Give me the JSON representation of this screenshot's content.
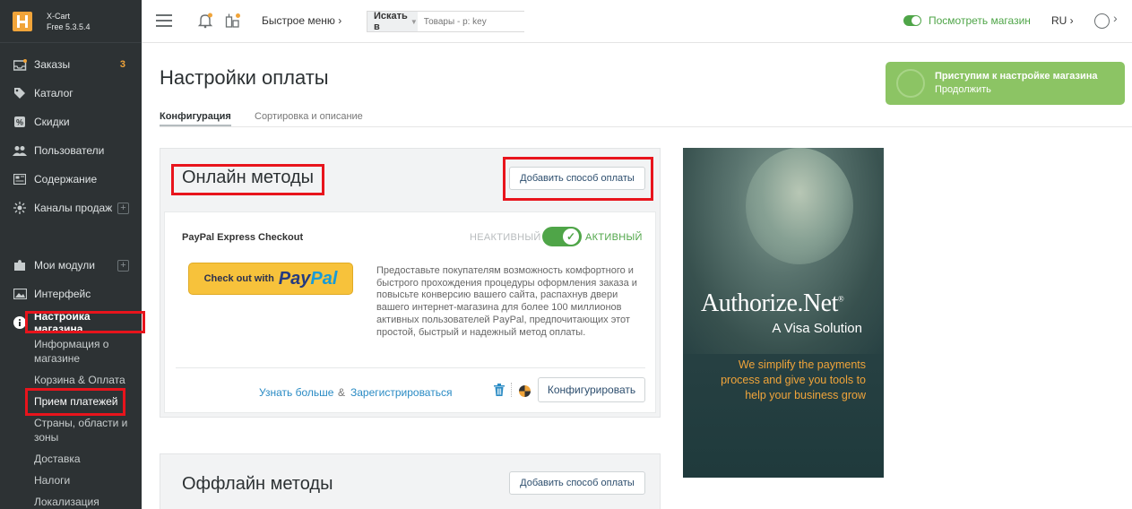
{
  "app": {
    "name": "X-Cart",
    "version": "Free 5.3.5.4"
  },
  "sidebar": {
    "items": [
      {
        "label": "Заказы",
        "badge": "3",
        "icon": "inbox-icon"
      },
      {
        "label": "Каталог",
        "icon": "tag-icon"
      },
      {
        "label": "Скидки",
        "icon": "discount-icon"
      },
      {
        "label": "Пользователи",
        "icon": "users-icon"
      },
      {
        "label": "Содержание",
        "icon": "content-icon"
      },
      {
        "label": "Каналы продаж",
        "icon": "sales-channels-icon",
        "plus": "+"
      },
      {
        "label": "Мои модули",
        "icon": "puzzle-icon",
        "plus": "+"
      },
      {
        "label": "Интерфейс",
        "icon": "image-icon"
      },
      {
        "label": "Настройка магазина",
        "icon": "info-icon"
      }
    ],
    "subitems": [
      "Информация о магазине",
      "Корзина & Оплата",
      "Прием платежей",
      "Страны, области и зоны",
      "Доставка",
      "Налоги",
      "Локализация"
    ]
  },
  "topbar": {
    "quick_menu": "Быстрое меню",
    "search_scope": "Искать в",
    "search_placeholder": "Товары - p: key",
    "view_store": "Посмотреть магазин",
    "language": "RU"
  },
  "page": {
    "title": "Настройки оплаты",
    "tabs": [
      "Конфигурация",
      "Сортировка и описание"
    ]
  },
  "setup_banner": {
    "line1": "Приступим к настройке магазина",
    "line2": "Продолжить"
  },
  "online": {
    "title": "Онлайн методы",
    "add_button": "Добавить способ оплаты",
    "method": {
      "name": "PayPal Express Checkout",
      "inactive_label": "НЕАКТИВНЫЙ",
      "active_label": "АКТИВНЫЙ",
      "enabled": true,
      "button_prefix": "Check out with",
      "button_pay": "Pay",
      "button_pal": "Pal",
      "description": "Предоставьте покупателям возможность комфортного и быстрого прохождения процедуры оформления заказа и повысьте конверсию вашего сайта, распахнув двери вашего интернет-магазина для более 100 миллионов активных пользователей PayPal, предпочитающих этот простой, быстрый и надежный метод оплаты.",
      "learn_more": "Узнать больше",
      "ampersand": "&",
      "register": "Зарегистрироваться",
      "configure": "Конфигурировать"
    }
  },
  "offline": {
    "title": "Оффлайн методы",
    "add_button": "Добавить способ оплаты"
  },
  "ad": {
    "brand": "Authorize.Net",
    "brand_mark": "®",
    "subtitle": "A Visa Solution",
    "tagline": "We simplify the payments process and give you tools to help your business grow"
  },
  "colors": {
    "sidebar_bg": "#2d3234",
    "accent_orange": "#f0a43a",
    "active_green": "#4fa548",
    "banner_green": "#8cc464",
    "link_blue": "#2a8bc4",
    "highlight_red": "#e8141c"
  }
}
